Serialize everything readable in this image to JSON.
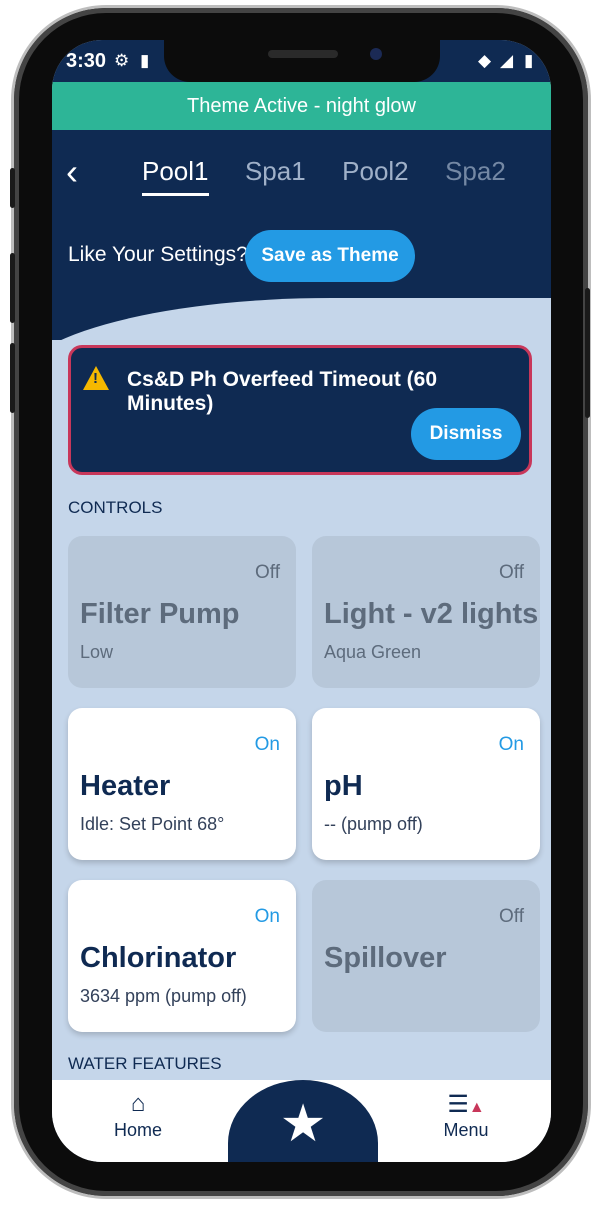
{
  "status_bar": {
    "time": "3:30"
  },
  "banner": {
    "text": "Theme Active - night glow"
  },
  "header": {
    "tabs": [
      "Pool1",
      "Spa1",
      "Pool2",
      "Spa2"
    ],
    "active_tab": "Pool1",
    "like_text": "Like Your Settings?",
    "save_theme_label": "Save as Theme"
  },
  "alert": {
    "message": "Cs&D Ph Overfeed Timeout (60 Minutes)",
    "dismiss_label": "Dismiss"
  },
  "controls": {
    "heading": "CONTROLS",
    "cards": [
      {
        "name": "Filter Pump",
        "state": "Off",
        "detail": "Low"
      },
      {
        "name": "Light - v2 lights",
        "state": "Off",
        "detail": "Aqua Green"
      },
      {
        "name": "Heater",
        "state": "On",
        "detail": "Idle: Set Point 68°"
      },
      {
        "name": "pH",
        "state": "On",
        "detail": "-- (pump off)"
      },
      {
        "name": "Chlorinator",
        "state": "On",
        "detail": "3634 ppm (pump off)"
      },
      {
        "name": "Spillover",
        "state": "Off",
        "detail": ""
      }
    ]
  },
  "water_features": {
    "heading": "WATER FEATURES"
  },
  "bottom_nav": {
    "home_label": "Home",
    "menu_label": "Menu",
    "favorites_icon": "star-icon"
  },
  "colors": {
    "navy": "#0f2a52",
    "accent_blue": "#239ae4",
    "banner_green": "#2db597",
    "alert_border": "#c8375a"
  }
}
